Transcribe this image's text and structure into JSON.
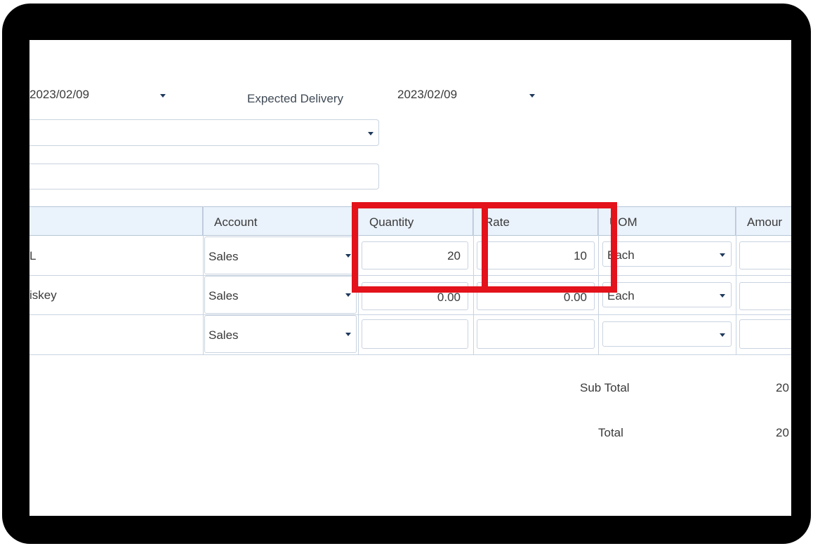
{
  "header": {
    "order_date": "2023/02/09",
    "expected_delivery_label": "Expected Delivery",
    "expected_delivery_date": "2023/02/09"
  },
  "table": {
    "columns": [
      "Account",
      "Quantity",
      "Rate",
      "UOM",
      "Amour"
    ],
    "rows": [
      {
        "item": "L",
        "account": "Sales",
        "quantity": "20",
        "rate": "10",
        "uom": "Each"
      },
      {
        "item": "iskey",
        "account": "Sales",
        "quantity": "0.00",
        "rate": "0.00",
        "uom": "Each"
      },
      {
        "item": "",
        "account": "Sales",
        "quantity": "",
        "rate": "",
        "uom": ""
      }
    ]
  },
  "totals": {
    "subtotal_label": "Sub Total",
    "subtotal_value": "20",
    "total_label": "Total",
    "total_value": "20"
  },
  "colors": {
    "highlight": "#e3121b",
    "header_bg": "#eaf2fb",
    "bezel": "#000000"
  }
}
